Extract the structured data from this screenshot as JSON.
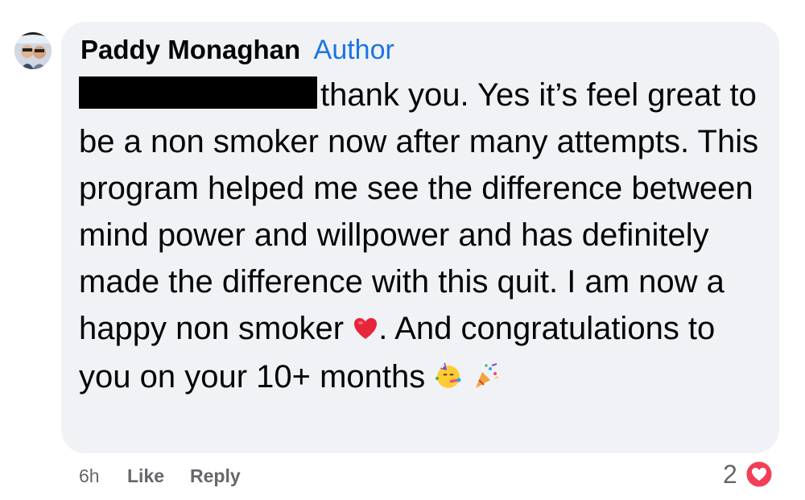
{
  "comment": {
    "author_name": "Paddy Monaghan",
    "author_badge": "Author",
    "text_line1": "thank you. Yes it’s feel great to be a non smoker now after many attempts. This program helped me see the difference between mind power and willpower and has definitely made the difference with this quit. I am now a happy non smoker",
    "text_line2": ". And congratulations to you on your 10+ months",
    "redacted": true
  },
  "footer": {
    "time": "6h",
    "like_label": "Like",
    "reply_label": "Reply",
    "reaction_count": "2"
  },
  "icons": {
    "heart": "red-heart-emoji",
    "party_face": "partying-face-emoji",
    "popper": "party-popper-emoji",
    "reaction": "love-reaction-icon"
  },
  "colors": {
    "bubble": "#f0f2f5",
    "author_badge": "#1b74e4",
    "secondary_text": "#65676b",
    "love_reaction": "#f33e58"
  }
}
